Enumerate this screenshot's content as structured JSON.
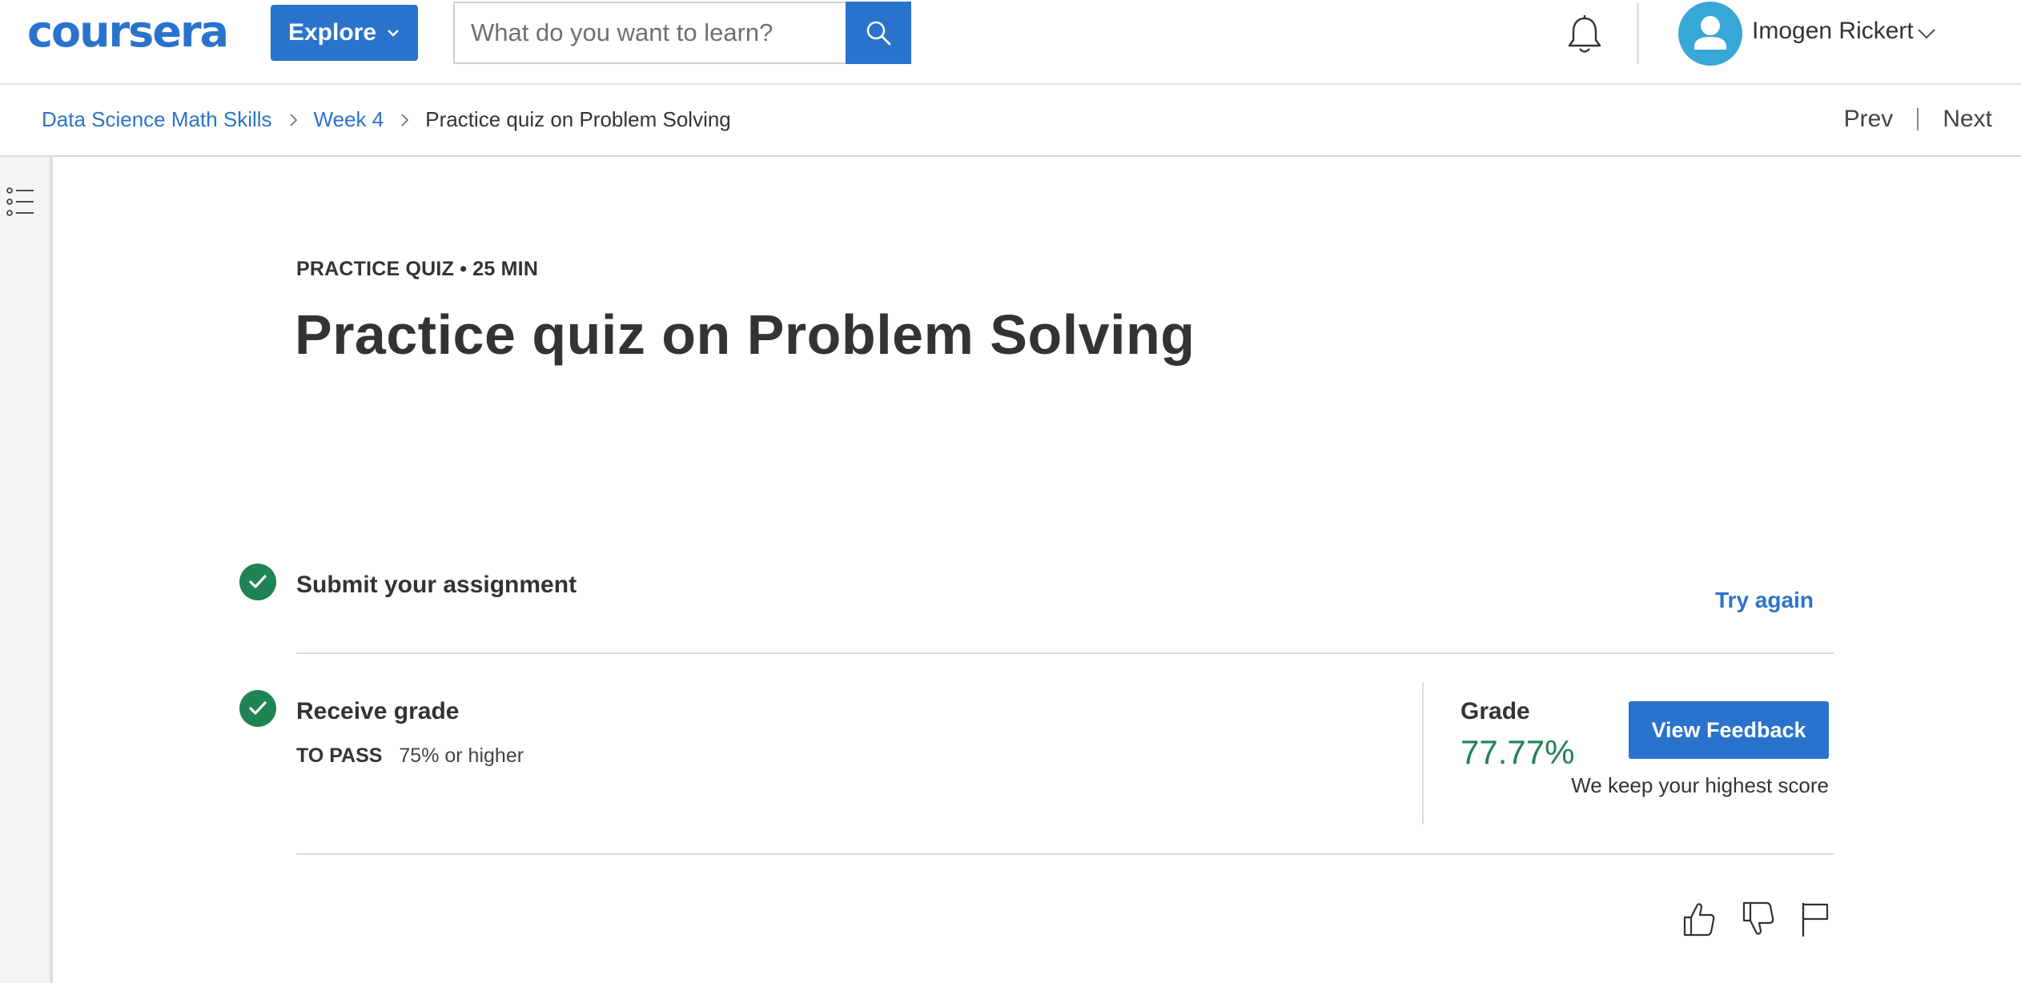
{
  "header": {
    "logo_text": "coursera",
    "explore_label": "Explore",
    "search_placeholder": "What do you want to learn?",
    "user_name": "Imogen Rickert"
  },
  "breadcrumb": {
    "items": [
      "Data Science Math Skills",
      "Week 4"
    ],
    "current": "Practice quiz on Problem Solving"
  },
  "nav": {
    "prev_label": "Prev",
    "next_label": "Next"
  },
  "quiz": {
    "eyebrow": "PRACTICE QUIZ • 25 MIN",
    "title": "Practice quiz on Problem Solving"
  },
  "steps": {
    "submit": {
      "title": "Submit your assignment",
      "action_label": "Try again"
    },
    "grade": {
      "title": "Receive grade",
      "to_pass_label": "TO PASS",
      "to_pass_value": "75% or higher",
      "grade_label": "Grade",
      "grade_value": "77.77%",
      "feedback_button": "View Feedback",
      "note": "We keep your highest score"
    }
  },
  "colors": {
    "brand_blue": "#2a73cc",
    "success_green": "#1f8354",
    "text_dark": "#333333"
  },
  "icons": {
    "search": "search-icon",
    "notifications": "bell-icon",
    "menu": "list-menu-icon",
    "like": "thumbs-up-icon",
    "dislike": "thumbs-down-icon",
    "report": "flag-icon"
  }
}
